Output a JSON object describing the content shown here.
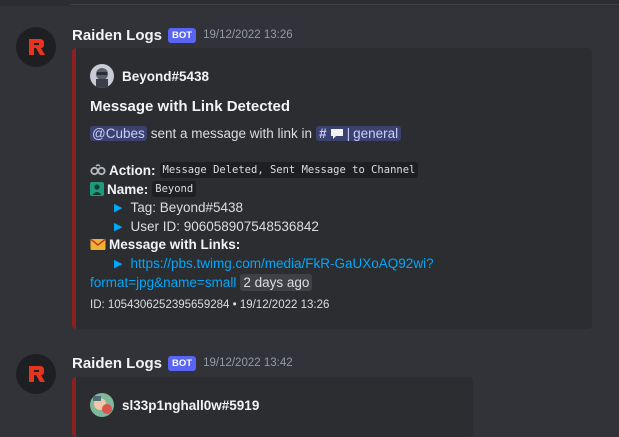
{
  "messages": [
    {
      "author": "Raiden Logs",
      "bot_tag": "BOT",
      "timestamp": "19/12/2022 13:26",
      "embed": {
        "author_name": "Beyond#5438",
        "title": "Message with Link Detected",
        "description": {
          "mention": "@Cubes",
          "text": "sent a message with link in",
          "channel": "general"
        },
        "action": {
          "name": "Action:",
          "value": "Message Deleted, Sent Message to Channel"
        },
        "name_field": {
          "name": "Name:",
          "value": "Beyond"
        },
        "tag": "Tag: Beyond#5438",
        "user_id": "User ID: 906058907548536842",
        "links_field": {
          "name": "Message with Links:"
        },
        "link_line1": "https://pbs.twimg.com/media/FkR-GaUXoAQ92wi?",
        "link_line2": "format=jpg&name=small",
        "ago": "2 days ago",
        "footer": "ID: 1054306252395659284 • 19/12/2022 13:26"
      }
    },
    {
      "author": "Raiden Logs",
      "bot_tag": "BOT",
      "timestamp": "19/12/2022 13:42",
      "embed": {
        "author_name": "sl33p1nghall0w#5919"
      }
    }
  ],
  "colors": {
    "background": "#313338",
    "embed_bg": "#2b2d31",
    "embed_border": "#8b2020",
    "bot_tag": "#5865f2",
    "link": "#00a8fc",
    "mention_bg": "#3c4270"
  }
}
